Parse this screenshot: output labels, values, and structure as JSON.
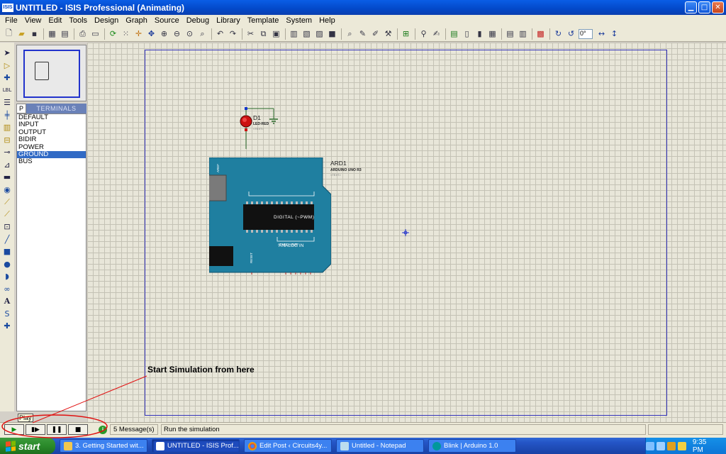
{
  "window": {
    "app_icon": "ISIS",
    "title": "UNTITLED - ISIS Professional (Animating)",
    "controls": [
      "minimize-icon",
      "maximize-icon",
      "close-icon"
    ]
  },
  "menu": [
    "File",
    "View",
    "Edit",
    "Tools",
    "Design",
    "Graph",
    "Source",
    "Debug",
    "Library",
    "Template",
    "System",
    "Help"
  ],
  "toolbar": {
    "rotation_value": "0°"
  },
  "left_tools": [
    "selection-mode",
    "component-mode",
    "junction-dot",
    "wire-label",
    "text-script",
    "buses",
    "subcircuit",
    "terminals",
    "device-pins",
    "graph",
    "tape-recorder",
    "generator",
    "voltage-probe",
    "current-probe",
    "virtual-instruments",
    "line",
    "box",
    "circle",
    "arc",
    "path",
    "text",
    "symbol",
    "marker"
  ],
  "terminals_panel": {
    "p_button": "P",
    "header": "TERMINALS",
    "items": [
      "DEFAULT",
      "INPUT",
      "OUTPUT",
      "BIDIR",
      "POWER",
      "GROUND",
      "BUS"
    ],
    "selected": "GROUND"
  },
  "schematic": {
    "led": {
      "ref": "D1",
      "value": "LED-RED",
      "text": "<TEXT>"
    },
    "arduino": {
      "ref": "ARD1",
      "value": "ARDUINO UNO R3",
      "text": "<TEXT>",
      "digital_label": "DIGITAL (~PWM)",
      "analog_label": "ANALOG IN",
      "chip_label": "ATMEGA328P",
      "aref": "AREF",
      "reset": "RESET"
    }
  },
  "annotation": {
    "callout_text": "Start Simulation from here"
  },
  "simulation": {
    "tooltip": "Play",
    "buttons": [
      "play",
      "step",
      "pause",
      "stop"
    ],
    "messages": "5 Message(s)",
    "status": "Run the simulation"
  },
  "taskbar": {
    "start": "start",
    "tasks": [
      {
        "label": "3. Getting Started wit...",
        "active": false
      },
      {
        "label": "UNTITLED - ISIS Prof...",
        "active": true
      },
      {
        "label": "Edit Post ‹ Circuits4y...",
        "active": false
      },
      {
        "label": "Untitled - Notepad",
        "active": false
      },
      {
        "label": "Blink | Arduino 1.0",
        "active": false
      }
    ],
    "clock": "9:35 PM"
  }
}
